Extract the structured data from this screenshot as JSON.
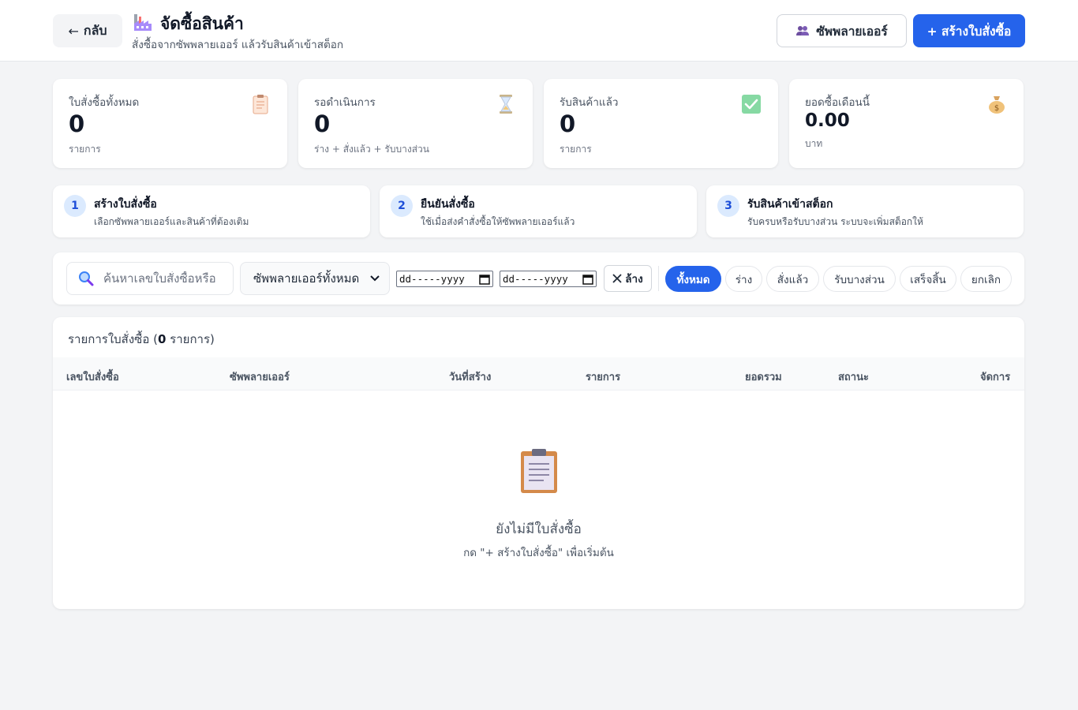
{
  "header": {
    "back_label": "กลับ",
    "back_arrow": "←",
    "title": "จัดซื้อสินค้า",
    "subtitle": "สั่งซื้อจากซัพพลายเออร์ แล้วรับสินค้าเข้าสต็อก",
    "suppliers_label": "ซัพพลายเออร์",
    "create_label": "+ สร้างใบสั่งซื้อ"
  },
  "stats": [
    {
      "label": "ใบสั่งซื้อทั้งหมด",
      "value": "0",
      "note": "รายการ",
      "icon": "clipboard-icon"
    },
    {
      "label": "รอดำเนินการ",
      "value": "0",
      "note": "ร่าง + สั่งแล้ว + รับบางส่วน",
      "icon": "hourglass-icon"
    },
    {
      "label": "รับสินค้าแล้ว",
      "value": "0",
      "note": "รายการ",
      "icon": "check-icon"
    },
    {
      "label": "ยอดซื้อเดือนนี้",
      "value": "0.00",
      "note": "บาท",
      "icon": "money-bag-icon"
    }
  ],
  "steps": [
    {
      "num": "1",
      "title": "สร้างใบสั่งซื้อ",
      "desc": "เลือกซัพพลายเออร์และสินค้าที่ต้องเติม"
    },
    {
      "num": "2",
      "title": "ยืนยันสั่งซื้อ",
      "desc": "ใช้เมื่อส่งคำสั่งซื้อให้ซัพพลายเออร์แล้ว"
    },
    {
      "num": "3",
      "title": "รับสินค้าเข้าสต็อก",
      "desc": "รับครบหรือรับบางส่วน ระบบจะเพิ่มสต็อกให้"
    }
  ],
  "filters": {
    "search_placeholder": "ค้นหาเลขใบสั่งซื้อหรือ",
    "supplier_selected": "ซัพพลายเออร์ทั้งหมด",
    "date_placeholder": "dd-----yyyy",
    "clear_label": "ล้าง",
    "status_tabs": [
      "ทั้งหมด",
      "ร่าง",
      "สั่งแล้ว",
      "รับบางส่วน",
      "เสร็จสิ้น",
      "ยกเลิก"
    ],
    "active_tab": "ทั้งหมด"
  },
  "table": {
    "heading_prefix": "รายการใบสั่งซื้อ (",
    "count": "0",
    "heading_suffix": " รายการ)",
    "columns": [
      "เลขใบสั่งซื้อ",
      "ซัพพลายเออร์",
      "วันที่สร้าง",
      "รายการ",
      "ยอดรวม",
      "สถานะ",
      "จัดการ"
    ],
    "empty_title": "ยังไม่มีใบสั่งซื้อ",
    "empty_hint": "กด \"+ สร้างใบสั่งซื้อ\" เพื่อเริ่มต้น"
  },
  "colors": {
    "accent": "#2563eb",
    "background": "#f3f4f6",
    "card": "#ffffff",
    "step_badge": "#dbeafe"
  }
}
